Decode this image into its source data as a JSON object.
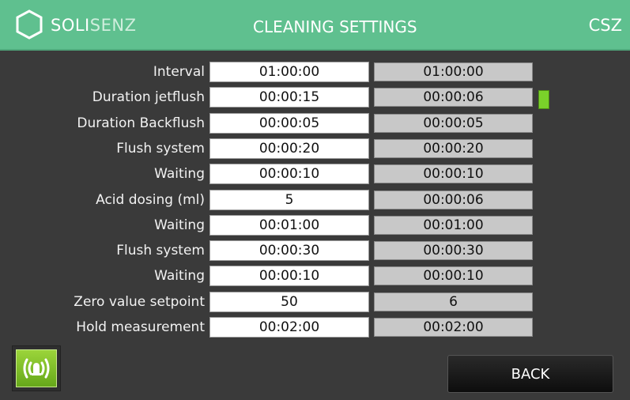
{
  "header": {
    "logo_text_main": "SOLI",
    "logo_text_accent": "SENZ",
    "title": "CLEANING SETTINGS",
    "device_code": "CSZ"
  },
  "rows": [
    {
      "label": "Interval",
      "setpoint": "01:00:00",
      "actual": "01:00:00"
    },
    {
      "label": "Duration jetflush",
      "setpoint": "00:00:15",
      "actual": "00:00:06"
    },
    {
      "label": "Duration  Backflush",
      "setpoint": "00:00:05",
      "actual": "00:00:05"
    },
    {
      "label": "Flush system",
      "setpoint": "00:00:20",
      "actual": "00:00:20"
    },
    {
      "label": "Waiting",
      "setpoint": "00:00:10",
      "actual": "00:00:10"
    },
    {
      "label": "Acid dosing (ml)",
      "setpoint": "5",
      "actual": "00:00:06"
    },
    {
      "label": "Waiting",
      "setpoint": "00:01:00",
      "actual": "00:01:00"
    },
    {
      "label": "Flush system",
      "setpoint": "00:00:30",
      "actual": "00:00:30"
    },
    {
      "label": "Waiting",
      "setpoint": "00:00:10",
      "actual": "00:00:10"
    },
    {
      "label": "Zero value setpoint",
      "setpoint": "50",
      "actual": "6"
    },
    {
      "label": "Hold measurement",
      "setpoint": "00:02:00",
      "actual": "00:02:00"
    }
  ],
  "status_indicator": {
    "color": "#7ad22a",
    "active_row": "Duration jetflush"
  },
  "footer": {
    "alarm_icon": "alarm-bell-icon",
    "back_label": "BACK"
  },
  "colors": {
    "header_bg": "#5fc08f",
    "body_bg": "#3a3a3a",
    "alarm_green": "#8cc63f"
  }
}
